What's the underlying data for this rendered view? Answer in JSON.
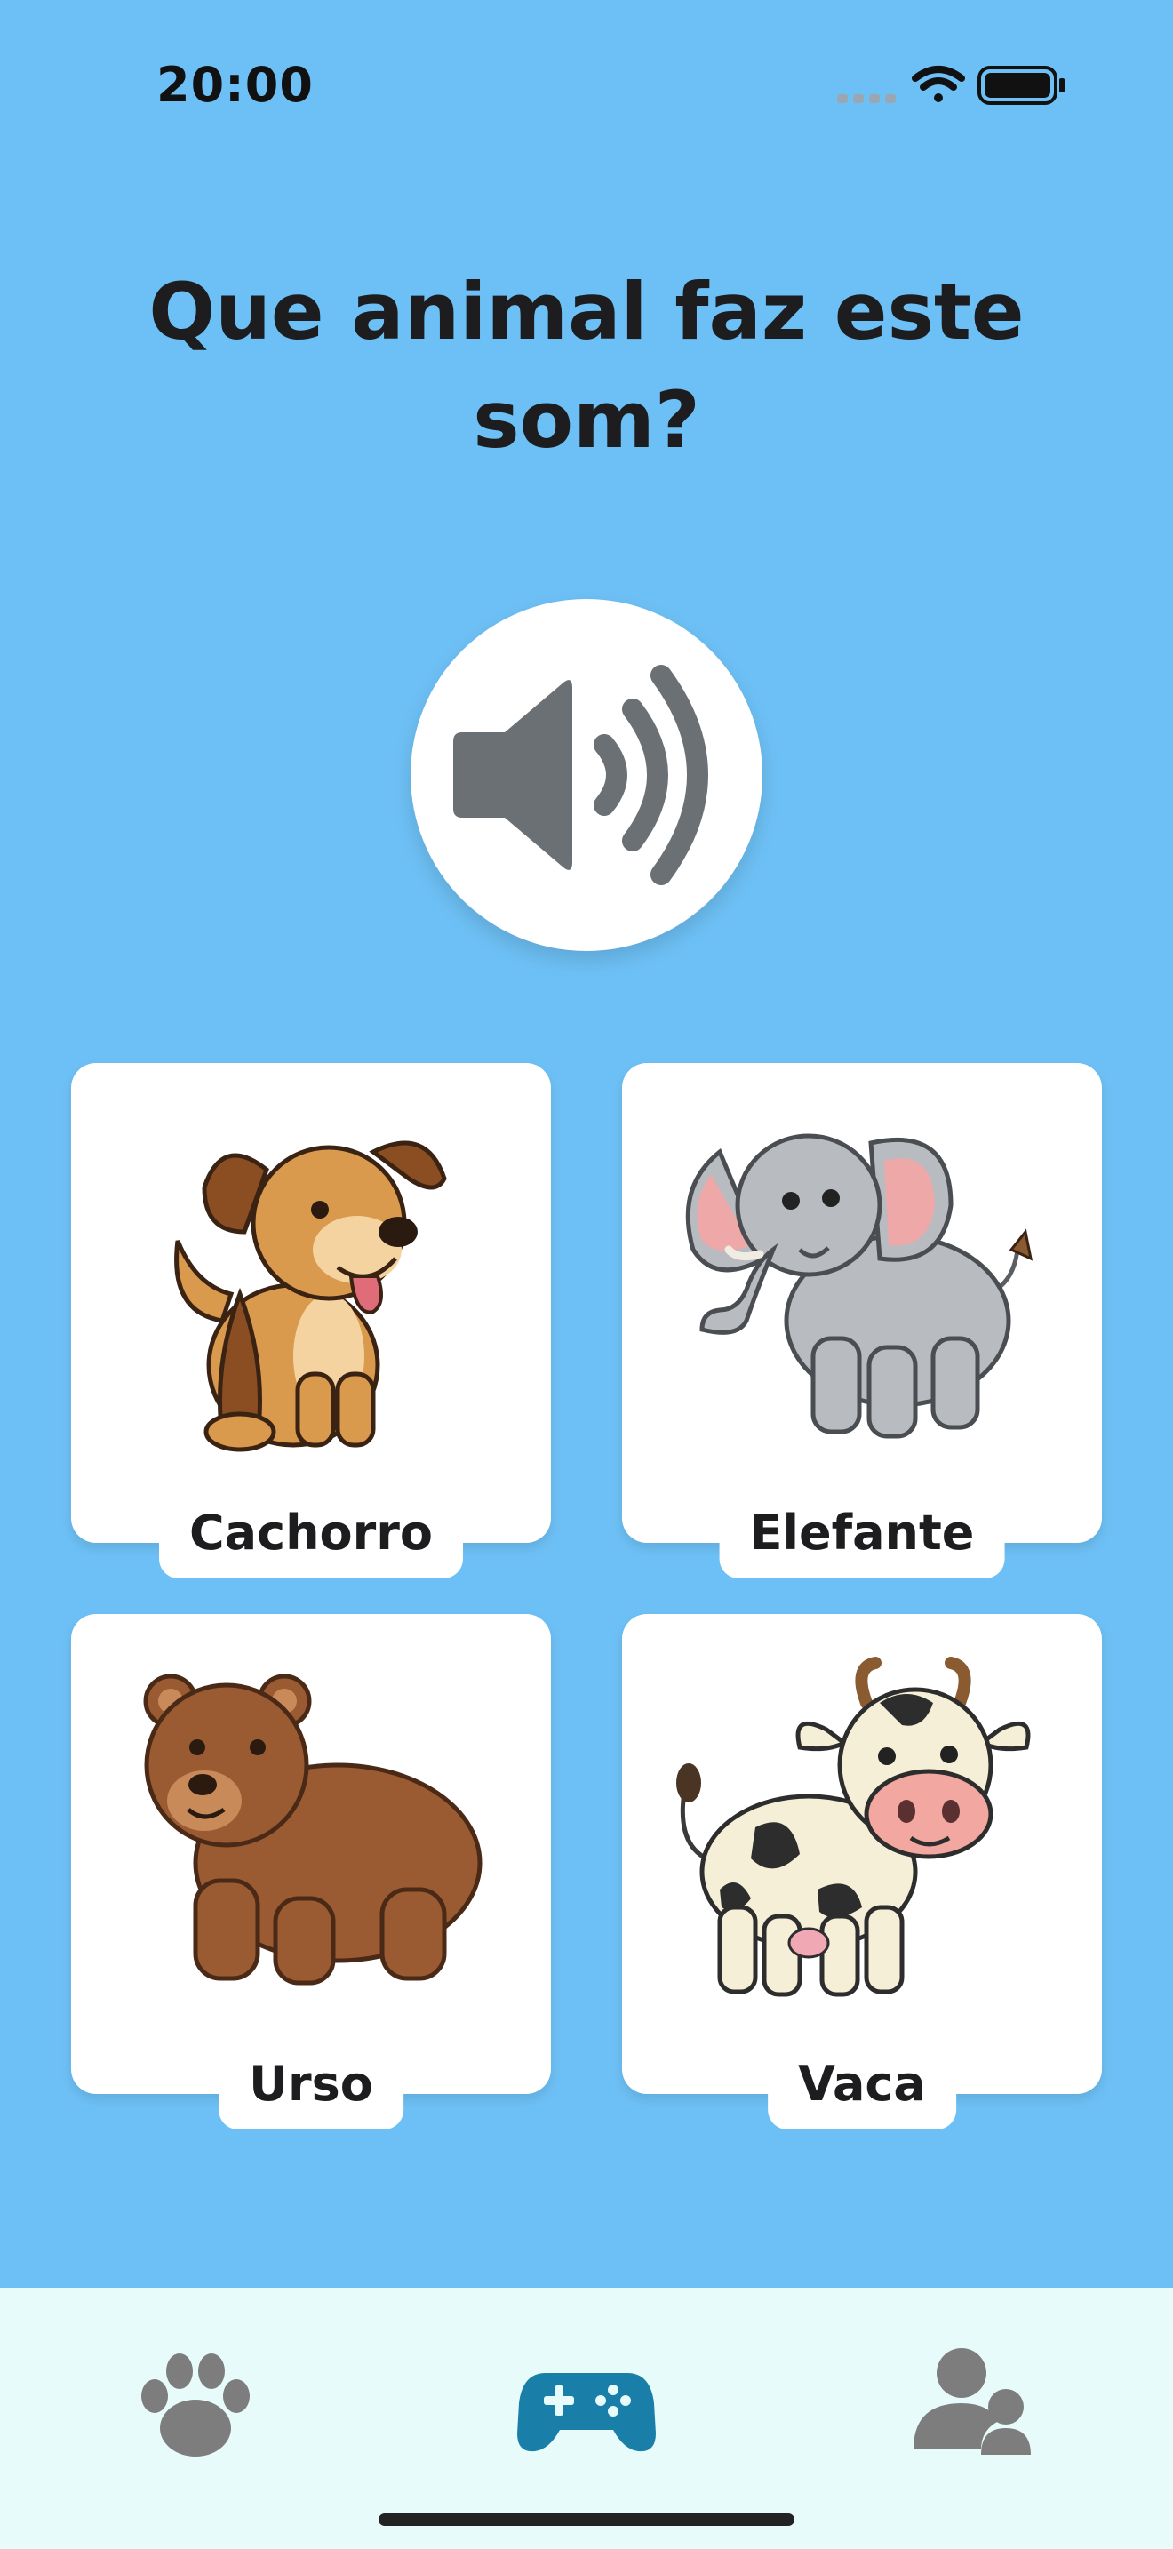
{
  "status_bar": {
    "time": "20:00",
    "icons": [
      "cellular-signal-icon",
      "wifi-icon",
      "battery-icon"
    ]
  },
  "question": {
    "line1": "Que animal faz este",
    "line2": "som?"
  },
  "sound_button": {
    "icon": "speaker-icon"
  },
  "options": [
    {
      "label": "Cachorro",
      "icon": "dog-icon"
    },
    {
      "label": "Elefante",
      "icon": "elephant-icon"
    },
    {
      "label": "Urso",
      "icon": "bear-icon"
    },
    {
      "label": "Vaca",
      "icon": "cow-icon"
    }
  ],
  "tab_bar": {
    "tabs": [
      {
        "icon": "paw-icon",
        "active": false
      },
      {
        "icon": "gamepad-icon",
        "active": true
      },
      {
        "icon": "users-icon",
        "active": false
      }
    ],
    "active_color": "#1a7fa8",
    "inactive_color": "#7d7d7d"
  },
  "colors": {
    "background": "#6dc0f5",
    "card": "#ffffff",
    "text": "#1d1d1f"
  }
}
